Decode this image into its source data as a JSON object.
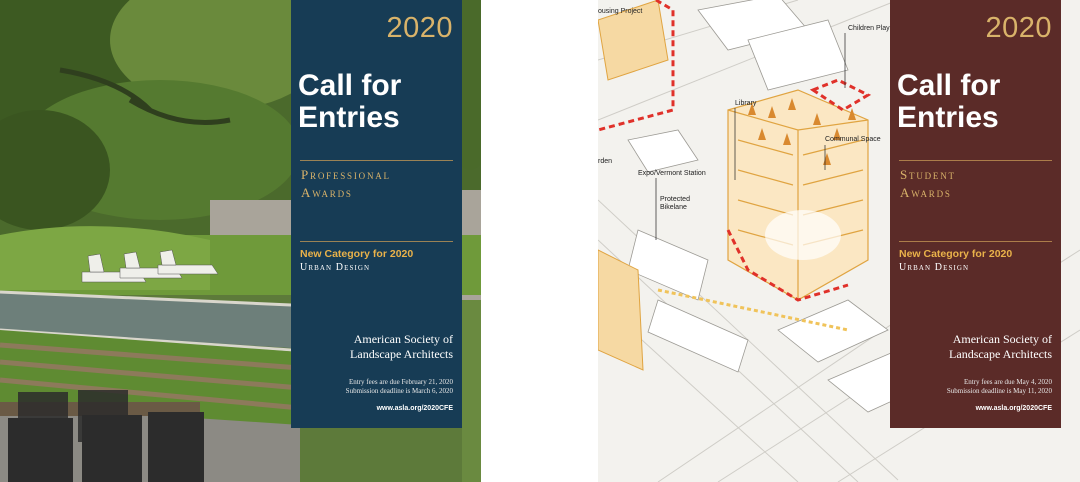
{
  "posters": [
    {
      "year": "2020",
      "headline": "Call for\nEntries",
      "award": "Professional\nAwards",
      "new_category": "New Category for 2020",
      "category": "Urban Design",
      "organization": "American Society of\nLandscape Architects",
      "fees": "Entry fees are due February 21, 2020\nSubmission deadline is March 6, 2020",
      "url": "www.asla.org/2020CFE",
      "panel_color": "#173c55"
    },
    {
      "year": "2020",
      "headline": "Call for\nEntries",
      "award": "Student\nAwards",
      "new_category": "New Category for 2020",
      "category": "Urban Design",
      "organization": "American Society of\nLandscape Architects",
      "fees": "Entry fees are due May 4, 2020\nSubmission deadline is May 11, 2020",
      "url": "www.asla.org/2020CFE",
      "panel_color": "#5b2b28",
      "diagram_labels": {
        "housing": "ousing Project",
        "children": "Children Play",
        "library": "Library",
        "communal": "Communal Space",
        "garden": "rden",
        "station": "Expo/Vermont Station",
        "bikelane": "Protected\nBikelane"
      }
    }
  ],
  "accent_color": "#d9b36a"
}
